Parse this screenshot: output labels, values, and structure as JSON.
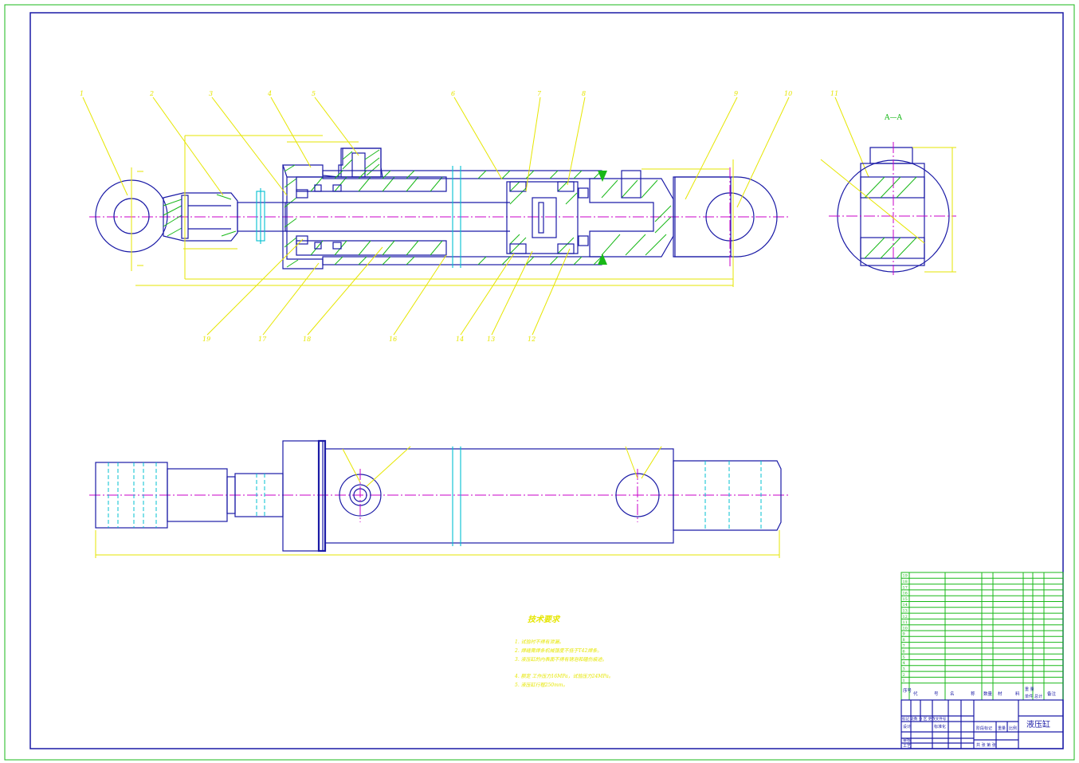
{
  "section_label": "A—A",
  "tech_requirements": {
    "title": "技术要求",
    "items": [
      "1. 试验时不得有泄漏。",
      "2. 焊缝需焊条机械强度不低于T42焊条。",
      "3. 液压缸的内表面不得有锈泡和磕伤痕迹。",
      "4. 额定 工作压力16MPa，试验压力24MPa。",
      "5. 液压缸行程250mm。"
    ]
  },
  "parts_list": {
    "headers": [
      "序号",
      "代",
      "号",
      "名",
      "称",
      "数量",
      "材",
      "料",
      "单件",
      "总计",
      "备注"
    ],
    "weight_header": "重 量",
    "rows": [
      {
        "no": "19"
      },
      {
        "no": "18"
      },
      {
        "no": "17"
      },
      {
        "no": "16"
      },
      {
        "no": "15"
      },
      {
        "no": "14"
      },
      {
        "no": "13"
      },
      {
        "no": "12"
      },
      {
        "no": "11"
      },
      {
        "no": "10"
      },
      {
        "no": "9"
      },
      {
        "no": "8"
      },
      {
        "no": "7"
      },
      {
        "no": "6"
      },
      {
        "no": "5"
      },
      {
        "no": "4"
      },
      {
        "no": "3"
      },
      {
        "no": "2"
      },
      {
        "no": "1"
      }
    ]
  },
  "title_block": {
    "drawing_title": "液压缸",
    "change_row": "标记 处数 分 区 更改文件号",
    "designer_label": "设计",
    "standardization": "标准化",
    "stage_mark": "阶段标记",
    "weight": "重量",
    "scale": "比例",
    "review": "审核",
    "process": "工艺",
    "approve_row": "共 张 第 张"
  },
  "balloons": [
    "1",
    "2",
    "3",
    "4",
    "5",
    "6",
    "7",
    "8",
    "9",
    "10",
    "11",
    "19",
    "17",
    "18",
    "16",
    "14",
    "13",
    "12"
  ]
}
